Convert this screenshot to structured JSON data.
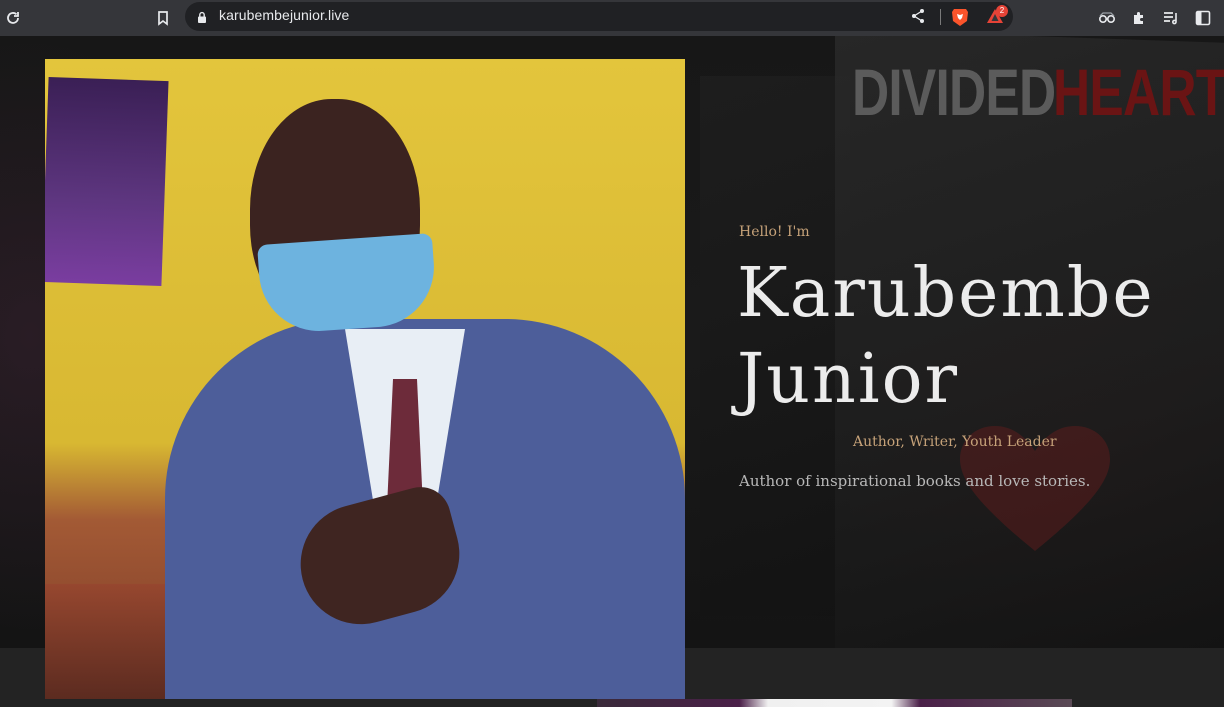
{
  "browser": {
    "url": "karubembejunior.live",
    "rewards_badge": "2",
    "icons": {
      "reload": "reload-icon",
      "bookmark": "bookmark-icon",
      "lock": "lock-icon",
      "share": "share-icon",
      "brave_shields": "brave-shields-icon",
      "brave_rewards": "brave-rewards-icon",
      "extension_glasses": "extension-icon",
      "extensions": "puzzle-icon",
      "reading_list": "reading-list-icon",
      "sidebar": "sidebar-icon"
    },
    "colors": {
      "toolbar": "#35363a",
      "omnibox": "#202124",
      "badge": "#e64337"
    }
  },
  "hero": {
    "greeting": "Hello! I'm",
    "name_line1": "Karubembe",
    "name_line2": "Junior",
    "roles": "Author, Writer, Youth Leader",
    "tagline": "Author of inspirational books and love stories.",
    "background_book_title": {
      "part1": "DIVIDED",
      "part2": "HEART"
    },
    "colors": {
      "accent": "#c6a279",
      "name": "#ececec",
      "tagline": "#b8b8b8"
    }
  }
}
